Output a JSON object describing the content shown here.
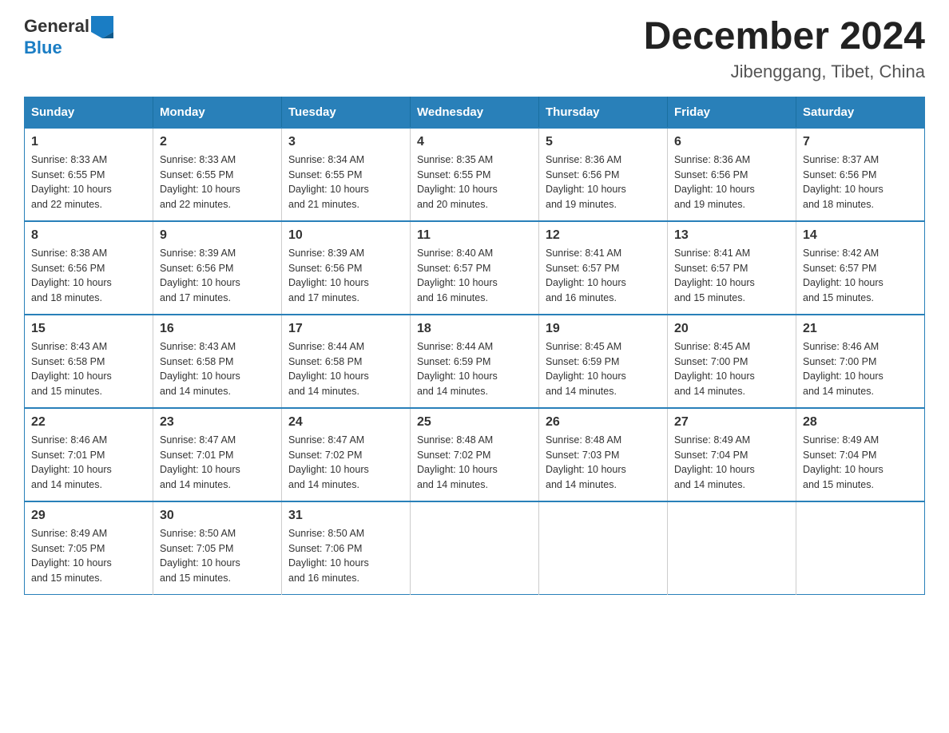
{
  "header": {
    "logo_text_general": "General",
    "logo_text_blue": "Blue",
    "month_year": "December 2024",
    "location": "Jibenggang, Tibet, China"
  },
  "weekdays": [
    "Sunday",
    "Monday",
    "Tuesday",
    "Wednesday",
    "Thursday",
    "Friday",
    "Saturday"
  ],
  "weeks": [
    [
      {
        "day": "1",
        "sunrise": "8:33 AM",
        "sunset": "6:55 PM",
        "daylight": "10 hours and 22 minutes."
      },
      {
        "day": "2",
        "sunrise": "8:33 AM",
        "sunset": "6:55 PM",
        "daylight": "10 hours and 22 minutes."
      },
      {
        "day": "3",
        "sunrise": "8:34 AM",
        "sunset": "6:55 PM",
        "daylight": "10 hours and 21 minutes."
      },
      {
        "day": "4",
        "sunrise": "8:35 AM",
        "sunset": "6:55 PM",
        "daylight": "10 hours and 20 minutes."
      },
      {
        "day": "5",
        "sunrise": "8:36 AM",
        "sunset": "6:56 PM",
        "daylight": "10 hours and 19 minutes."
      },
      {
        "day": "6",
        "sunrise": "8:36 AM",
        "sunset": "6:56 PM",
        "daylight": "10 hours and 19 minutes."
      },
      {
        "day": "7",
        "sunrise": "8:37 AM",
        "sunset": "6:56 PM",
        "daylight": "10 hours and 18 minutes."
      }
    ],
    [
      {
        "day": "8",
        "sunrise": "8:38 AM",
        "sunset": "6:56 PM",
        "daylight": "10 hours and 18 minutes."
      },
      {
        "day": "9",
        "sunrise": "8:39 AM",
        "sunset": "6:56 PM",
        "daylight": "10 hours and 17 minutes."
      },
      {
        "day": "10",
        "sunrise": "8:39 AM",
        "sunset": "6:56 PM",
        "daylight": "10 hours and 17 minutes."
      },
      {
        "day": "11",
        "sunrise": "8:40 AM",
        "sunset": "6:57 PM",
        "daylight": "10 hours and 16 minutes."
      },
      {
        "day": "12",
        "sunrise": "8:41 AM",
        "sunset": "6:57 PM",
        "daylight": "10 hours and 16 minutes."
      },
      {
        "day": "13",
        "sunrise": "8:41 AM",
        "sunset": "6:57 PM",
        "daylight": "10 hours and 15 minutes."
      },
      {
        "day": "14",
        "sunrise": "8:42 AM",
        "sunset": "6:57 PM",
        "daylight": "10 hours and 15 minutes."
      }
    ],
    [
      {
        "day": "15",
        "sunrise": "8:43 AM",
        "sunset": "6:58 PM",
        "daylight": "10 hours and 15 minutes."
      },
      {
        "day": "16",
        "sunrise": "8:43 AM",
        "sunset": "6:58 PM",
        "daylight": "10 hours and 14 minutes."
      },
      {
        "day": "17",
        "sunrise": "8:44 AM",
        "sunset": "6:58 PM",
        "daylight": "10 hours and 14 minutes."
      },
      {
        "day": "18",
        "sunrise": "8:44 AM",
        "sunset": "6:59 PM",
        "daylight": "10 hours and 14 minutes."
      },
      {
        "day": "19",
        "sunrise": "8:45 AM",
        "sunset": "6:59 PM",
        "daylight": "10 hours and 14 minutes."
      },
      {
        "day": "20",
        "sunrise": "8:45 AM",
        "sunset": "7:00 PM",
        "daylight": "10 hours and 14 minutes."
      },
      {
        "day": "21",
        "sunrise": "8:46 AM",
        "sunset": "7:00 PM",
        "daylight": "10 hours and 14 minutes."
      }
    ],
    [
      {
        "day": "22",
        "sunrise": "8:46 AM",
        "sunset": "7:01 PM",
        "daylight": "10 hours and 14 minutes."
      },
      {
        "day": "23",
        "sunrise": "8:47 AM",
        "sunset": "7:01 PM",
        "daylight": "10 hours and 14 minutes."
      },
      {
        "day": "24",
        "sunrise": "8:47 AM",
        "sunset": "7:02 PM",
        "daylight": "10 hours and 14 minutes."
      },
      {
        "day": "25",
        "sunrise": "8:48 AM",
        "sunset": "7:02 PM",
        "daylight": "10 hours and 14 minutes."
      },
      {
        "day": "26",
        "sunrise": "8:48 AM",
        "sunset": "7:03 PM",
        "daylight": "10 hours and 14 minutes."
      },
      {
        "day": "27",
        "sunrise": "8:49 AM",
        "sunset": "7:04 PM",
        "daylight": "10 hours and 14 minutes."
      },
      {
        "day": "28",
        "sunrise": "8:49 AM",
        "sunset": "7:04 PM",
        "daylight": "10 hours and 15 minutes."
      }
    ],
    [
      {
        "day": "29",
        "sunrise": "8:49 AM",
        "sunset": "7:05 PM",
        "daylight": "10 hours and 15 minutes."
      },
      {
        "day": "30",
        "sunrise": "8:50 AM",
        "sunset": "7:05 PM",
        "daylight": "10 hours and 15 minutes."
      },
      {
        "day": "31",
        "sunrise": "8:50 AM",
        "sunset": "7:06 PM",
        "daylight": "10 hours and 16 minutes."
      },
      null,
      null,
      null,
      null
    ]
  ],
  "labels": {
    "sunrise": "Sunrise:",
    "sunset": "Sunset:",
    "daylight": "Daylight:"
  }
}
